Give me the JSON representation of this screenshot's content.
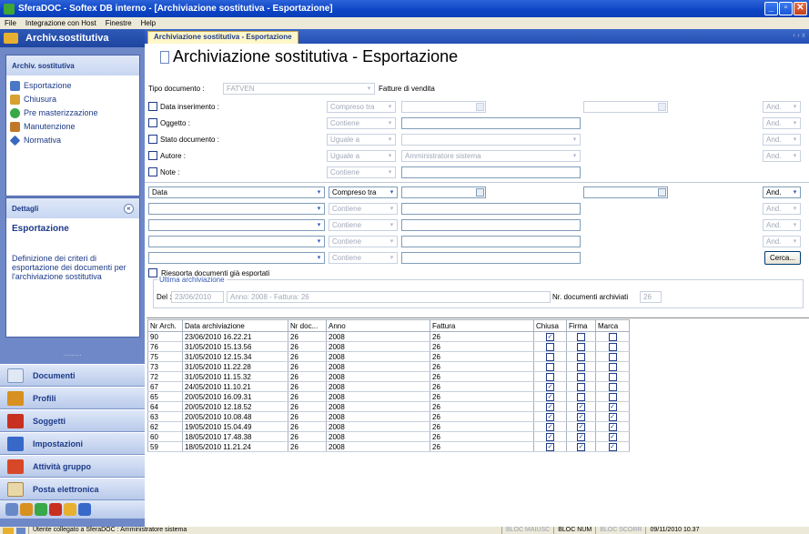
{
  "window": {
    "title": "SferaDOC - Softex DB interno - [Archiviazione sostitutiva - Esportazione]"
  },
  "menu": [
    "File",
    "Integrazione con Host",
    "Finestre",
    "Help"
  ],
  "left": {
    "header": "Archiv.sostitutiva",
    "nav_panel_title": "Archiv. sostitutiva",
    "nav_items": [
      {
        "label": "Esportazione",
        "icon": "export-doc-icon"
      },
      {
        "label": "Chiusura",
        "icon": "lock-doc-icon"
      },
      {
        "label": "Pre masterizzazione",
        "icon": "cd-icon"
      },
      {
        "label": "Manutenzione",
        "icon": "wrench-icon"
      },
      {
        "label": "Normativa",
        "icon": "diamond-icon"
      }
    ],
    "details_title": "Dettagli",
    "details_heading": "Esportazione",
    "details_text": "Definizione dei criteri di esportazione dei documenti per l'archiviazione sostitutiva",
    "big_buttons": [
      "Documenti",
      "Profili",
      "Soggetti",
      "Impostazioni",
      "Attività gruppo",
      "Posta elettronica"
    ],
    "grip": "........."
  },
  "tab": {
    "label": "Archiviazione sostitutiva - Esportazione",
    "arrows": "‹ › x"
  },
  "page": {
    "title": "Archiviazione sostitutiva - Esportazione",
    "tipo_documento_label": "Tipo documento :",
    "tipo_documento_value": "FATVEN",
    "tipo_documento_desc": "Fatture di vendita",
    "filters": [
      {
        "label": "Data inserimento :",
        "op": "Compreso tra",
        "value": "",
        "value2": "",
        "and": "And."
      },
      {
        "label": "Oggetto :",
        "op": "Contiene",
        "value": "",
        "and": "And."
      },
      {
        "label": "Stato documento :",
        "op": "Uguale a",
        "value": "",
        "and": "And."
      },
      {
        "label": "Autore :",
        "op": "Uguale a",
        "value": "Amministratore sistema",
        "and": "And."
      },
      {
        "label": "Note :",
        "op": "Contiene",
        "value": ""
      }
    ],
    "custom_filters": [
      {
        "field": "Data",
        "op": "Compreso tra",
        "and": "And."
      },
      {
        "field": "",
        "op": "Contiene",
        "and": "And."
      },
      {
        "field": "",
        "op": "Contiene",
        "and": "And."
      },
      {
        "field": "",
        "op": "Contiene",
        "and": "And."
      },
      {
        "field": "",
        "op": "Contiene"
      }
    ],
    "cerca_label": "Cerca...",
    "riesporta_label": "Riesporta documenti già esportati",
    "ultima_label": "Ultima archiviazione",
    "del_label": "Del :",
    "del_value": "23/06/2010",
    "anno_value": "Anno: 2008 - Fattura: 26",
    "nr_doc_label": "Nr. documenti archiviati",
    "nr_doc_value": "26"
  },
  "grid": {
    "columns": [
      "Nr Arch.",
      "Data archiviazione",
      "Nr doc...",
      "Anno",
      "Fattura",
      "Chiusa",
      "Firma",
      "Marca"
    ],
    "rows": [
      [
        "90",
        "23/06/2010 16.22.21",
        "26",
        "2008",
        "26",
        true,
        false,
        false
      ],
      [
        "76",
        "31/05/2010 15.13.56",
        "26",
        "2008",
        "26",
        false,
        false,
        false
      ],
      [
        "75",
        "31/05/2010 12.15.34",
        "26",
        "2008",
        "26",
        false,
        false,
        false
      ],
      [
        "73",
        "31/05/2010 11.22.28",
        "26",
        "2008",
        "26",
        false,
        false,
        false
      ],
      [
        "72",
        "31/05/2010 11.15.32",
        "26",
        "2008",
        "26",
        false,
        false,
        false
      ],
      [
        "67",
        "24/05/2010 11.10.21",
        "26",
        "2008",
        "26",
        true,
        false,
        false
      ],
      [
        "65",
        "20/05/2010 16.09.31",
        "26",
        "2008",
        "26",
        true,
        false,
        false
      ],
      [
        "64",
        "20/05/2010 12.18.52",
        "26",
        "2008",
        "26",
        true,
        true,
        true
      ],
      [
        "63",
        "20/05/2010 10.08.48",
        "26",
        "2008",
        "26",
        true,
        true,
        true
      ],
      [
        "62",
        "19/05/2010 15.04.49",
        "26",
        "2008",
        "26",
        true,
        true,
        true
      ],
      [
        "60",
        "18/05/2010 17.48.38",
        "26",
        "2008",
        "26",
        true,
        true,
        true
      ],
      [
        "59",
        "18/05/2010 11.21.24",
        "26",
        "2008",
        "26",
        true,
        true,
        true
      ]
    ]
  },
  "status": {
    "user": "Utente collegato a SferaDOC : Amministratore sistema",
    "maiusc": "BLOC MAIUSC",
    "num": "BLOC NUM",
    "scorr": "BLOC SCORR",
    "datetime": "09/11/2010 10.37"
  }
}
